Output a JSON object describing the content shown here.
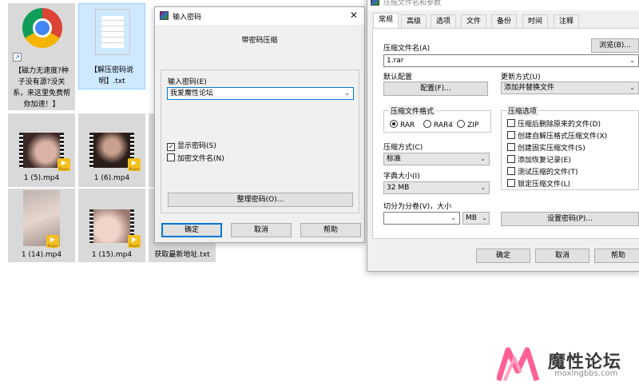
{
  "desktop": {
    "items": [
      {
        "label": "【磁力无速度?种子没有源?没关系，来这里免费帮你加速！】",
        "kind": "shortcut"
      },
      {
        "label": "【解压密码说明】.txt",
        "kind": "text-file"
      },
      {
        "label": "1 (5).mp4",
        "kind": "video"
      },
      {
        "label": "1 (6).mp4",
        "kind": "video"
      },
      {
        "label": "1 (14).mp4",
        "kind": "video"
      },
      {
        "label": "1 (15).mp4",
        "kind": "video"
      },
      {
        "label": "获取最新地址.txt",
        "kind": "text-file"
      }
    ],
    "badge_text": "Player"
  },
  "password_dialog": {
    "title": "输入密码",
    "subtitle": "带密码压缩",
    "password_label": "输入密码(E)",
    "password_value": "我爱魔性论坛",
    "show_password_label": "显示密码(S)",
    "show_password_checked": true,
    "encrypt_names_label": "加密文件名(N)",
    "encrypt_names_checked": false,
    "organize_button": "整理密码(O)...",
    "ok_button": "确定",
    "cancel_button": "取消",
    "help_button": "帮助"
  },
  "archive_dialog": {
    "title": "压缩文件名和参数",
    "tabs": [
      "常规",
      "高级",
      "选项",
      "文件",
      "备份",
      "时间",
      "注释"
    ],
    "active_tab": "常规",
    "archive_name_label": "压缩文件名(A)",
    "archive_name_value": "1.rar",
    "browse_button": "浏览(B)...",
    "profile_label": "默认配置",
    "profile_button": "配置(F)...",
    "update_mode_label": "更新方式(U)",
    "update_mode_value": "添加并替换文件",
    "format_group": "压缩文件格式",
    "formats": [
      "RAR",
      "RAR4",
      "ZIP"
    ],
    "selected_format": "RAR",
    "options_group": "压缩选项",
    "options": [
      "压缩后删除原来的文件(D)",
      "创建自解压格式压缩文件(X)",
      "创建固实压缩文件(S)",
      "添加恢复记录(E)",
      "测试压缩的文件(T)",
      "锁定压缩文件(L)"
    ],
    "method_label": "压缩方式(C)",
    "method_value": "标准",
    "dict_label": "字典大小(I)",
    "dict_value": "32 MB",
    "split_label": "切分为分卷(V)，大小",
    "split_value": "",
    "split_unit": "MB",
    "set_password_button": "设置密码(P)...",
    "ok_button": "确定",
    "cancel_button": "取消",
    "help_button": "帮助"
  },
  "watermark": {
    "name": "魔性论坛",
    "url": "moxingbbs.com"
  },
  "colors": {
    "accent": "#0078d7",
    "selection": "#cde8ff",
    "watermark_pink": "#ff4f8b"
  }
}
